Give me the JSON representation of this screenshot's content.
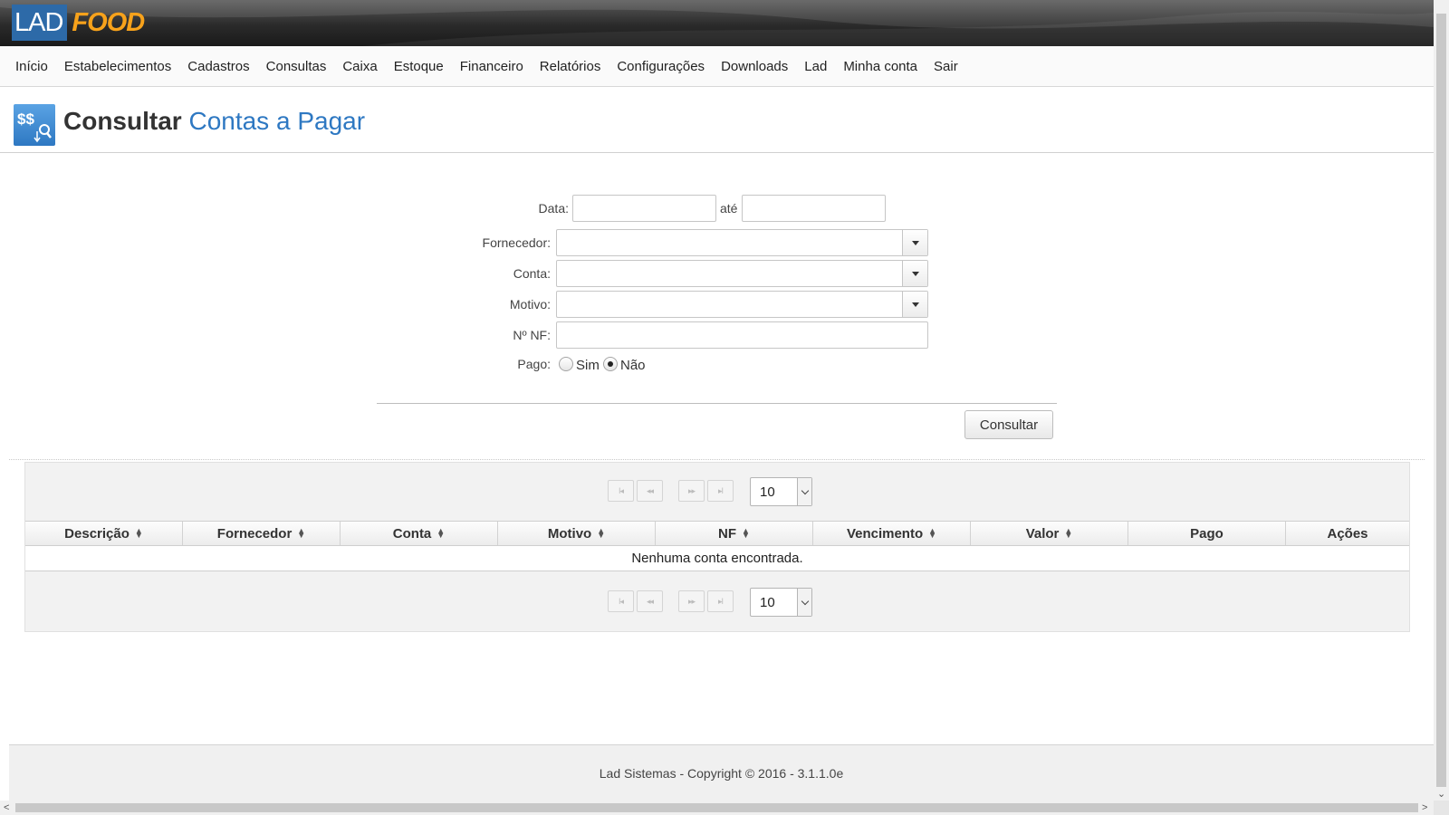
{
  "header": {
    "logo_lad": "LAD",
    "logo_food": "FOOD"
  },
  "nav": {
    "items": [
      "Início",
      "Estabelecimentos",
      "Cadastros",
      "Consultas",
      "Caixa",
      "Estoque",
      "Financeiro",
      "Relatórios",
      "Configurações",
      "Downloads",
      "Lad",
      "Minha conta",
      "Sair"
    ]
  },
  "title": {
    "icon": "money-search-icon",
    "icon_text": "$$",
    "main": "Consultar",
    "sub": "Contas a Pagar"
  },
  "form": {
    "data_label": "Data:",
    "ate_label": "até",
    "data_from": "",
    "data_to": "",
    "fornecedor_label": "Fornecedor:",
    "fornecedor_value": "",
    "conta_label": "Conta:",
    "conta_value": "",
    "motivo_label": "Motivo:",
    "motivo_value": "",
    "nf_label": "Nº NF:",
    "nf_value": "",
    "pago_label": "Pago:",
    "pago_options": [
      "Sim",
      "Não"
    ],
    "pago_selected": "Não",
    "submit_label": "Consultar"
  },
  "table": {
    "rows_per_page": "10",
    "pager_icons": [
      "first-page-icon",
      "prev-page-icon",
      "next-page-icon",
      "last-page-icon"
    ],
    "pager_glyphs": [
      "I◂",
      "◂◂",
      "▸▸",
      "▸I"
    ],
    "columns": [
      {
        "label": "Descrição",
        "sortable": true
      },
      {
        "label": "Fornecedor",
        "sortable": true
      },
      {
        "label": "Conta",
        "sortable": true
      },
      {
        "label": "Motivo",
        "sortable": true
      },
      {
        "label": "NF",
        "sortable": true
      },
      {
        "label": "Vencimento",
        "sortable": true
      },
      {
        "label": "Valor",
        "sortable": true
      },
      {
        "label": "Pago",
        "sortable": false
      },
      {
        "label": "Ações",
        "sortable": false
      }
    ],
    "empty_message": "Nenhuma conta encontrada."
  },
  "footer": {
    "text": "Lad Sistemas - Copyright © 2016 - 3.1.1.0e"
  },
  "colors": {
    "brand_blue": "#2e78c2",
    "brand_orange": "#f7a21b"
  }
}
